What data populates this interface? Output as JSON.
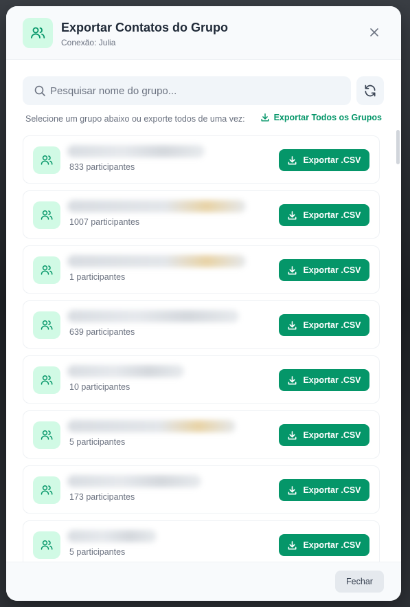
{
  "header": {
    "title": "Exportar Contatos do Grupo",
    "subtitle": "Conexão: Julia",
    "icon": "users-icon"
  },
  "search": {
    "placeholder": "Pesquisar nome do grupo...",
    "value": ""
  },
  "hint": "Selecione um grupo abaixo ou exporte todos de uma vez:",
  "export_all_label": "Exportar Todos os Grupos",
  "export_csv_label": "Exportar .CSV",
  "groups": [
    {
      "count_text": "833 participantes"
    },
    {
      "count_text": "1007 participantes"
    },
    {
      "count_text": "1 participantes"
    },
    {
      "count_text": "639 participantes"
    },
    {
      "count_text": "10 participantes"
    },
    {
      "count_text": "5 participantes"
    },
    {
      "count_text": "173 participantes"
    },
    {
      "count_text": "5 participantes"
    }
  ],
  "footer": {
    "close_label": "Fechar"
  },
  "colors": {
    "accent": "#059669",
    "icon_bg": "#d1fae5",
    "muted_text": "#6b7280"
  }
}
